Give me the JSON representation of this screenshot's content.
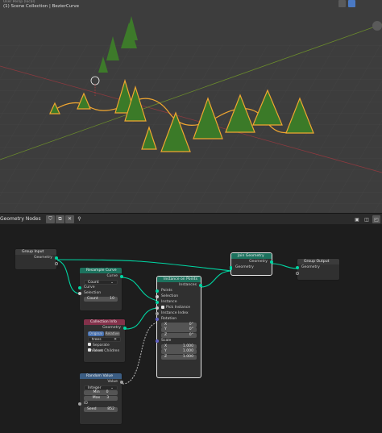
{
  "viewport": {
    "header_dim": "User Persp (local)",
    "header_collection": "(1) Scene Collection | BezierCurve"
  },
  "node_editor": {
    "title": "Geometry Nodes"
  },
  "nodes": {
    "group_input": {
      "title": "Group Input",
      "geometry": "Geometry"
    },
    "resample": {
      "title": "Resample Curve",
      "curve_out": "Curve",
      "mode": "Count",
      "curve_in": "Curve",
      "selection": "Selection",
      "count_label": "Count",
      "count_value": "10"
    },
    "collection_info": {
      "title": "Collection Info",
      "geometry": "Geometry",
      "tab_original": "Original",
      "tab_relative": "Relative",
      "collection": "trees",
      "separate_children": "Separate Children",
      "reset_children": "Reset Children"
    },
    "random_value": {
      "title": "Random Value",
      "value": "Value",
      "type": "Integer",
      "min_label": "Min",
      "min_value": "0",
      "max_label": "Max",
      "max_value": "3",
      "id": "ID",
      "seed_label": "Seed",
      "seed_value": "852"
    },
    "instance_on_points": {
      "title": "Instance on Points",
      "instances": "Instances",
      "points": "Points",
      "selection": "Selection",
      "instance": "Instance",
      "pick_instance": "Pick Instance",
      "instance_index": "Instance Index",
      "rotation": "Rotation",
      "rx_label": "X",
      "rx": "0°",
      "ry_label": "Y",
      "ry": "0°",
      "rz_label": "Z",
      "rz": "0°",
      "scale": "Scale",
      "sx_label": "X",
      "sx": "1.000",
      "sy_label": "Y",
      "sy": "1.000",
      "sz_label": "Z",
      "sz": "1.000"
    },
    "join_geometry": {
      "title": "Join Geometry",
      "geometry_out": "Geometry",
      "geometry_in": "Geometry"
    },
    "group_output": {
      "title": "Group Output",
      "geometry": "Geometry"
    }
  },
  "colors": {
    "geometry_socket": "#00d6a3",
    "header_geometry": "#1d725e",
    "header_input": "#83314a",
    "header_function": "#3b5d83",
    "curve_highlight": "#f0a630"
  }
}
